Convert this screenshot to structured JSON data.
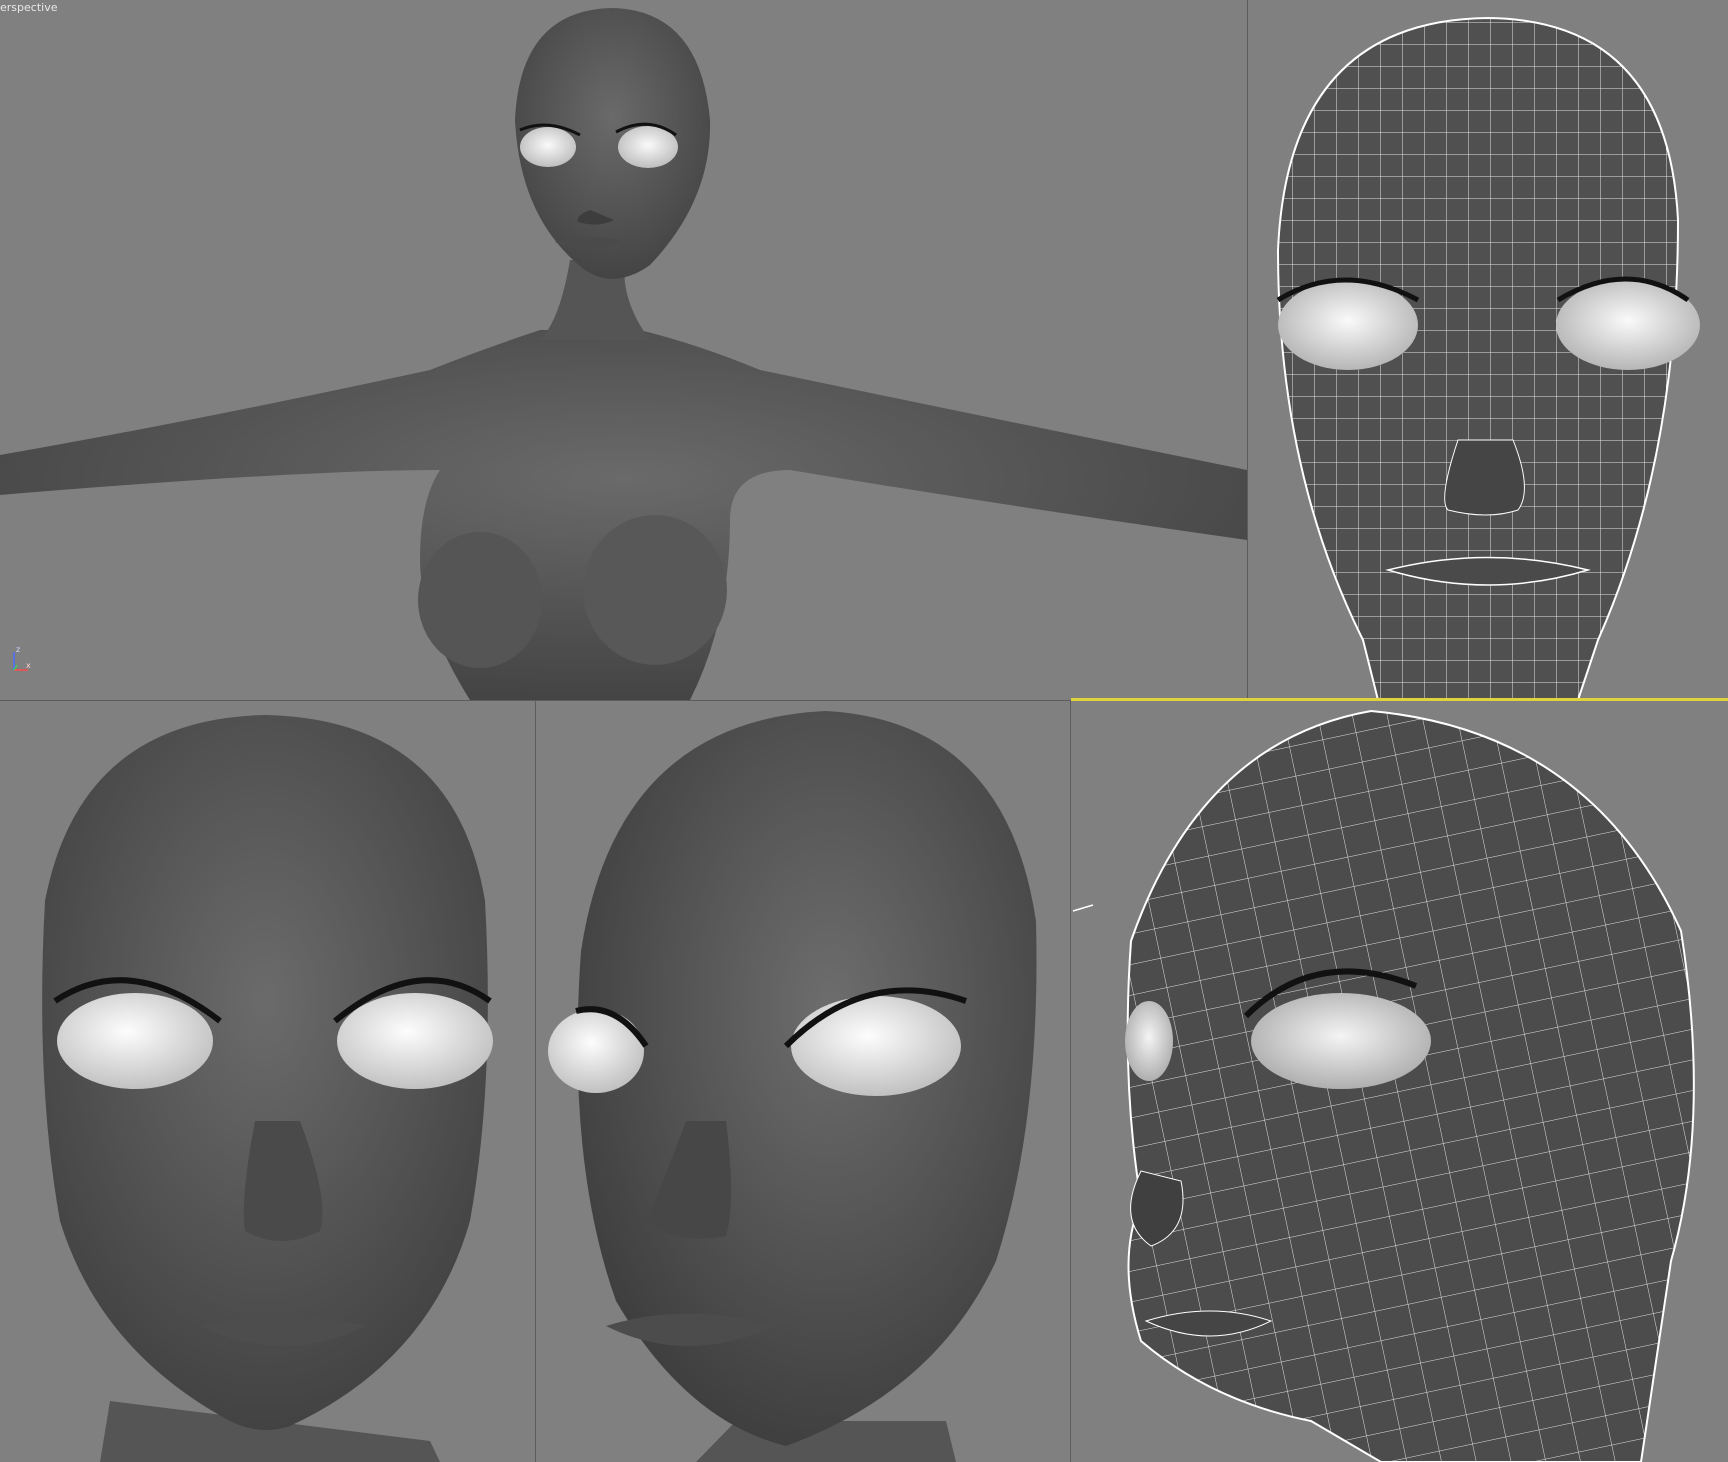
{
  "viewports": {
    "perspective": {
      "label": "erspective"
    },
    "front_wire": {
      "label": ""
    },
    "front_shaded": {
      "label": ""
    },
    "three_quarter_shaded": {
      "label": ""
    },
    "side_wire": {
      "label": ""
    }
  },
  "axis_gizmo": {
    "z_label": "z",
    "x_label": "x"
  },
  "colors": {
    "viewport_bg": "#808080",
    "active_border": "#e0d23a",
    "wire": "#ffffff",
    "skin": "#5e5e5e"
  },
  "icons": [
    "axis-gizmo-icon"
  ]
}
